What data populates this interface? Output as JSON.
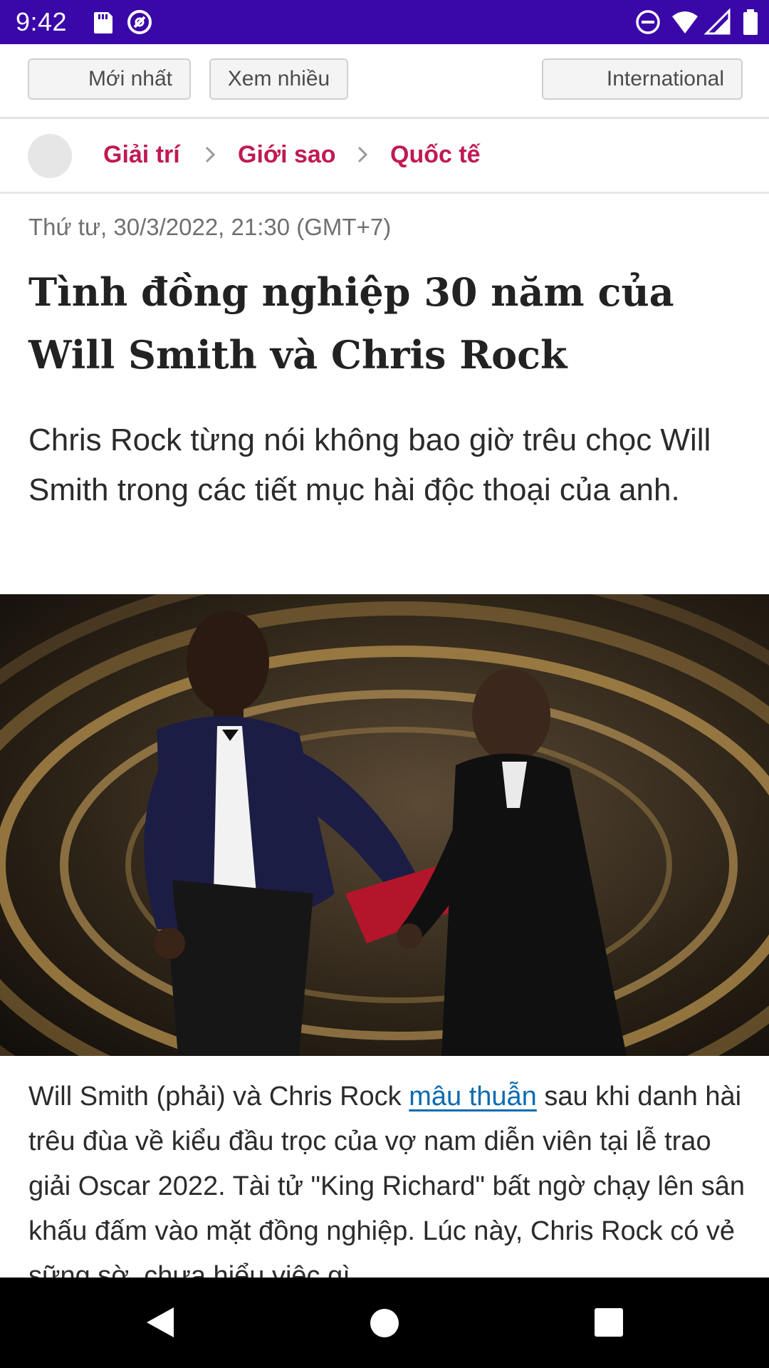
{
  "status_bar": {
    "time": "9:42",
    "left_icons": [
      "sd-card-icon",
      "at-sign-icon"
    ],
    "right_icons": [
      "do-not-disturb-icon",
      "wifi-icon",
      "signal-icon",
      "battery-icon"
    ],
    "background": "#3a07a8"
  },
  "top_nav": {
    "buttons": [
      {
        "label": "Mới nhất"
      },
      {
        "label": "Xem nhiều"
      },
      {
        "label": "International"
      }
    ]
  },
  "breadcrumb": {
    "items": [
      "Giải trí",
      "Giới sao",
      "Quốc tế"
    ],
    "color": "#c01a50"
  },
  "article": {
    "date": "Thứ tư, 30/3/2022, 21:30 (GMT+7)",
    "title": "Tình đồng nghiệp 30 năm của Will Smith và Chris Rock",
    "lead": "Chris Rock từng nói không bao giờ trêu chọc Will Smith trong các tiết mục hài độc thoại của anh.",
    "caption": {
      "before_link": "Will Smith (phải) và Chris Rock ",
      "link_text": "mâu thuẫn",
      "after_link": " sau khi danh hài trêu đùa về kiểu đầu trọc của vợ nam diễn viên tại lễ trao giải Oscar 2022. Tài tử \"King Richard\" bất ngờ chạy lên sân khấu đấm vào mặt đồng nghiệp. Lúc này, Chris Rock có vẻ sững sờ, chưa hiểu việc gì"
    }
  },
  "nav_bar": {
    "buttons": [
      "back-icon",
      "home-icon",
      "recents-icon"
    ]
  }
}
